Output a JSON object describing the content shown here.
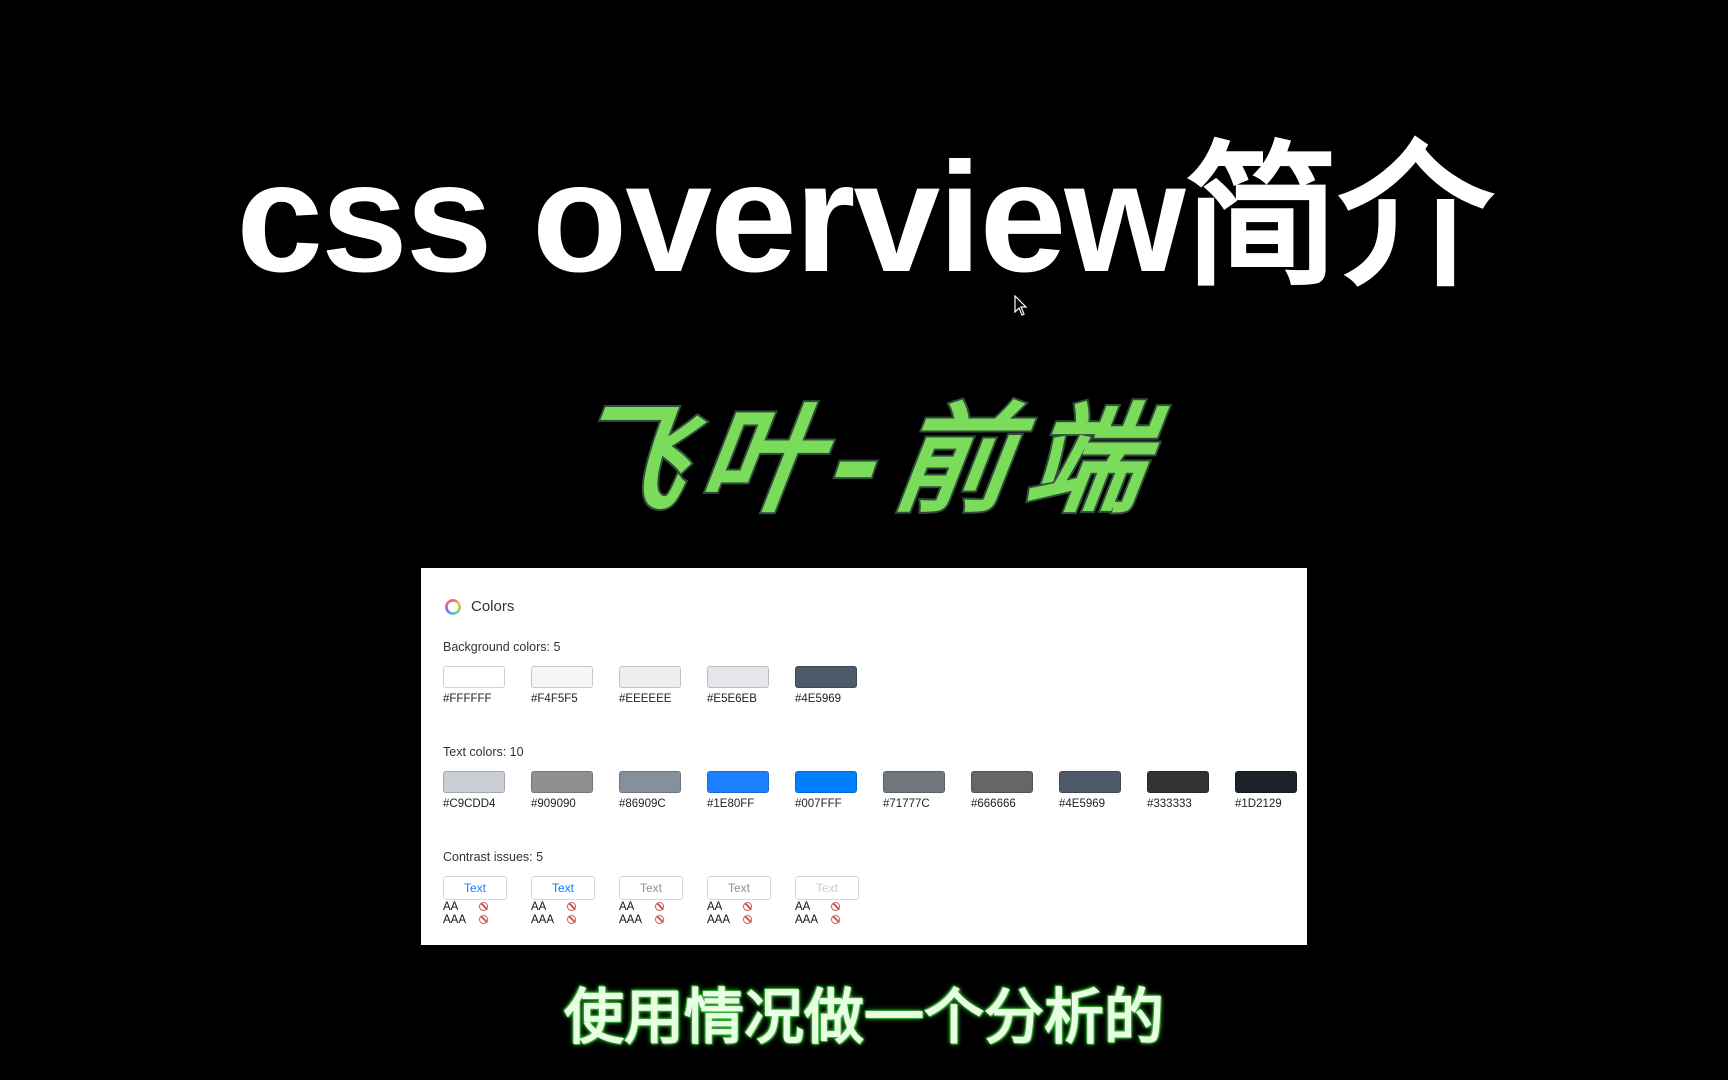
{
  "video": {
    "title": "css overview简介",
    "brand": "飞叶-前端",
    "subtitle": "使用情况做一个分析的"
  },
  "panel": {
    "title": "Colors",
    "icon": "color-ring-icon",
    "background_colors": {
      "label": "Background colors: 5",
      "items": [
        {
          "hex": "#FFFFFF",
          "color": "#FFFFFF"
        },
        {
          "hex": "#F4F5F5",
          "color": "#F4F5F5"
        },
        {
          "hex": "#EEEEEE",
          "color": "#EEEEEE"
        },
        {
          "hex": "#E5E6EB",
          "color": "#E5E6EB"
        },
        {
          "hex": "#4E5969",
          "color": "#4E5969"
        }
      ]
    },
    "text_colors": {
      "label": "Text colors: 10",
      "items": [
        {
          "hex": "#C9CDD4",
          "color": "#C9CDD4"
        },
        {
          "hex": "#909090",
          "color": "#909090"
        },
        {
          "hex": "#86909C",
          "color": "#86909C"
        },
        {
          "hex": "#1E80FF",
          "color": "#1E80FF"
        },
        {
          "hex": "#007FFF",
          "color": "#007FFF"
        },
        {
          "hex": "#71777C",
          "color": "#71777C"
        },
        {
          "hex": "#666666",
          "color": "#666666"
        },
        {
          "hex": "#4E5969",
          "color": "#4E5969"
        },
        {
          "hex": "#333333",
          "color": "#333333"
        },
        {
          "hex": "#1D2129",
          "color": "#1D2129"
        }
      ]
    },
    "contrast_issues": {
      "label": "Contrast issues: 5",
      "items": [
        {
          "sample": "Text",
          "text_color": "#1E80FF",
          "aa": "AA",
          "aaa": "AAA",
          "aa_status": "fail",
          "aaa_status": "fail"
        },
        {
          "sample": "Text",
          "text_color": "#007FFF",
          "aa": "AA",
          "aaa": "AAA",
          "aa_status": "fail",
          "aaa_status": "fail"
        },
        {
          "sample": "Text",
          "text_color": "#909090",
          "aa": "AA",
          "aaa": "AAA",
          "aa_status": "fail",
          "aaa_status": "fail"
        },
        {
          "sample": "Text",
          "text_color": "#86909C",
          "aa": "AA",
          "aaa": "AAA",
          "aa_status": "fail",
          "aaa_status": "fail"
        },
        {
          "sample": "Text",
          "text_color": "#C9CDD4",
          "aa": "AA",
          "aaa": "AAA",
          "aa_status": "fail",
          "aaa_status": "fail"
        }
      ]
    }
  }
}
